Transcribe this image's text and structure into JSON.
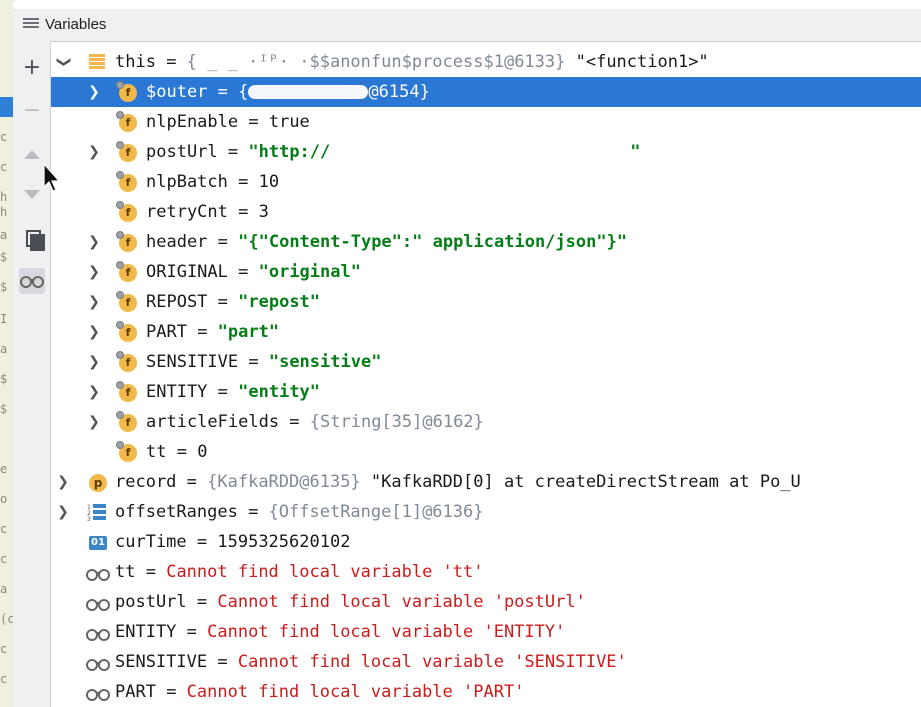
{
  "window": {
    "title": "Variables"
  },
  "left_strip_chars": [
    "c",
    "c",
    "h",
    "h",
    "a",
    "$",
    "$",
    "I",
    "a",
    "$",
    "$",
    "",
    "e",
    "o",
    "c",
    "c",
    "a",
    "(c",
    "c",
    "c"
  ],
  "toolbar": {
    "add_label": "+",
    "remove_label": "−"
  },
  "rows": [
    {
      "name": "this",
      "eq": " = ",
      "ref": "{ _ _ ·ᴵᴾ· ·$$anonfun$process$1@6133}",
      "value": " \"<function1>\""
    },
    {
      "name": "$outer",
      "eq": " = ",
      "ref": "{",
      "ref2": "@6154}"
    },
    {
      "name": "nlpEnable",
      "eq": " = ",
      "value": "true"
    },
    {
      "name": "postUrl",
      "eq": " = ",
      "value": "\"http://",
      "value2": "\""
    },
    {
      "name": "nlpBatch",
      "eq": " = ",
      "value": "10"
    },
    {
      "name": "retryCnt",
      "eq": " = ",
      "value": "3"
    },
    {
      "name": "header",
      "eq": " = ",
      "value": "\"{\"Content-Type\":\" application/json\"}\""
    },
    {
      "name": "ORIGINAL",
      "eq": " = ",
      "value": "\"original\""
    },
    {
      "name": "REPOST",
      "eq": " = ",
      "value": "\"repost\""
    },
    {
      "name": "PART",
      "eq": " = ",
      "value": "\"part\""
    },
    {
      "name": "SENSITIVE",
      "eq": " = ",
      "value": "\"sensitive\""
    },
    {
      "name": "ENTITY",
      "eq": " = ",
      "value": "\"entity\""
    },
    {
      "name": "articleFields",
      "eq": " = ",
      "ref": "{String[35]@6162}"
    },
    {
      "name": "tt",
      "eq": " = ",
      "value": "0"
    },
    {
      "name": "record",
      "eq": " = ",
      "ref": "{KafkaRDD@6135}",
      "value": " \"KafkaRDD[0] at createDirectStream at Po_U"
    },
    {
      "name": "offsetRanges",
      "eq": " = ",
      "ref": "{OffsetRange[1]@6136}"
    },
    {
      "name": "curTime",
      "eq": " = ",
      "value": "1595325620102"
    },
    {
      "name": "tt",
      "eq": " = ",
      "error": "Cannot find local variable 'tt'"
    },
    {
      "name": "postUrl",
      "eq": " = ",
      "error": "Cannot find local variable 'postUrl'"
    },
    {
      "name": "ENTITY",
      "eq": " = ",
      "error": "Cannot find local variable 'ENTITY'"
    },
    {
      "name": "SENSITIVE",
      "eq": " = ",
      "error": "Cannot find local variable 'SENSITIVE'"
    },
    {
      "name": "PART",
      "eq": " = ",
      "error": "Cannot find local variable 'PART'"
    }
  ],
  "icons": {
    "field_letter": "f",
    "param_letter": "p",
    "primitive_label": "01"
  },
  "colors": {
    "selection": "#2a78d4",
    "string": "#067d17",
    "error": "#cc1b1b",
    "reference": "#7f8a96"
  }
}
